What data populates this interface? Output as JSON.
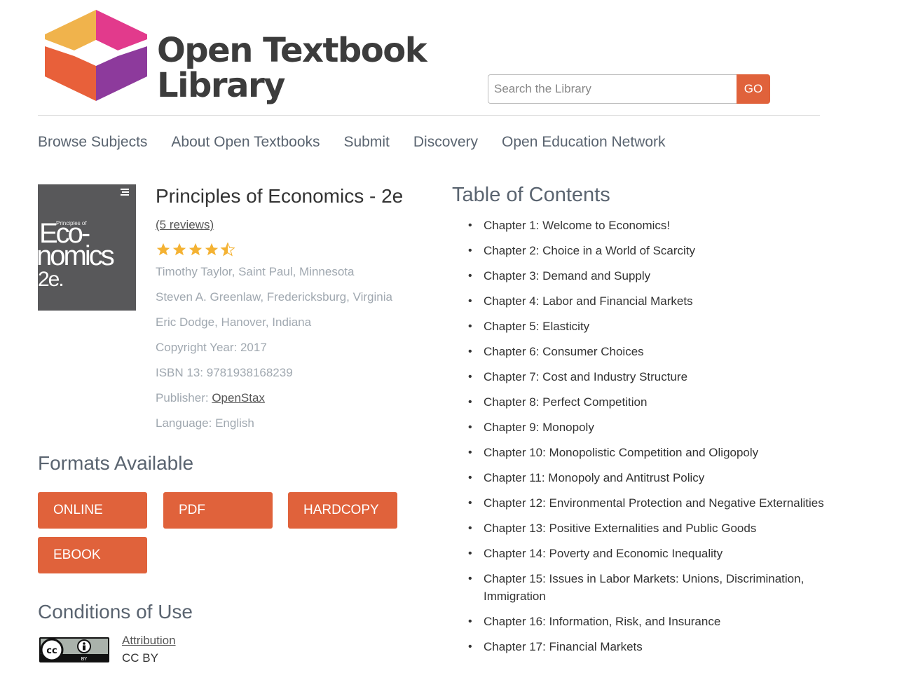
{
  "brand": {
    "line1": "Open Textbook",
    "line2": "Library"
  },
  "search": {
    "placeholder": "Search the Library",
    "go_label": "GO"
  },
  "nav": [
    "Browse Subjects",
    "About Open Textbooks",
    "Submit",
    "Discovery",
    "Open Education Network"
  ],
  "book": {
    "cover": {
      "small": "Principles of",
      "line1": "Eco-",
      "line2": "nomics",
      "line3": "2e."
    },
    "title": "Principles of Economics - 2e",
    "reviews": "(5 reviews)",
    "rating": 4.5,
    "authors": [
      "Timothy Taylor, Saint Paul, Minnesota",
      "Steven A. Greenlaw, Fredericksburg, Virginia",
      "Eric Dodge, Hanover, Indiana"
    ],
    "copyright": "Copyright Year: 2017",
    "isbn": "ISBN 13: 9781938168239",
    "publisher_label": "Publisher: ",
    "publisher": "OpenStax",
    "language": "Language: English"
  },
  "formats": {
    "heading": "Formats Available",
    "buttons": [
      "ONLINE",
      "PDF",
      "HARDCOPY",
      "EBOOK"
    ]
  },
  "conditions": {
    "heading": "Conditions of Use",
    "license_link": "Attribution",
    "license": "CC BY",
    "badge_text": "BY"
  },
  "toc": {
    "heading": "Table of Contents",
    "chapters": [
      "Chapter 1: Welcome to Economics!",
      "Chapter 2: Choice in a World of Scarcity",
      "Chapter 3: Demand and Supply",
      "Chapter 4: Labor and Financial Markets",
      "Chapter 5: Elasticity",
      "Chapter 6: Consumer Choices",
      "Chapter 7: Cost and Industry Structure",
      "Chapter 8: Perfect Competition",
      "Chapter 9: Monopoly",
      "Chapter 10: Monopolistic Competition and Oligopoly",
      "Chapter 11: Monopoly and Antitrust Policy",
      "Chapter 12: Environmental Protection and Negative Externalities",
      "Chapter 13: Positive Externalities and Public Goods",
      "Chapter 14: Poverty and Economic Inequality",
      "Chapter 15: Issues in Labor Markets: Unions, Discrimination, Immigration",
      "Chapter 16: Information, Risk, and Insurance",
      "Chapter 17: Financial Markets"
    ]
  },
  "colors": {
    "accent": "#e0623b",
    "nav_text": "#5a6470",
    "meta_text": "#a0a8b0",
    "star": "#f4b233"
  }
}
